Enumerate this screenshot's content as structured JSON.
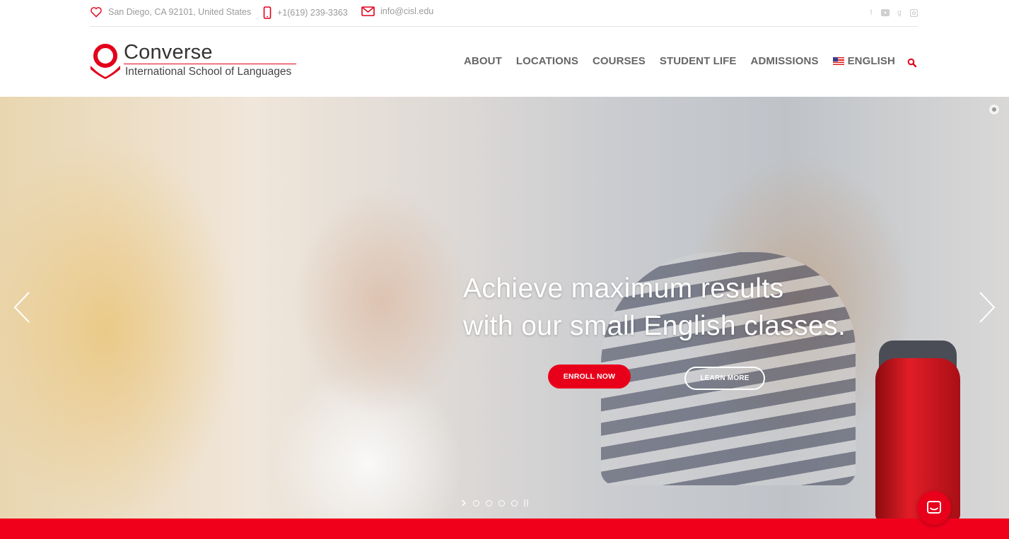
{
  "topbar": {
    "address": "San Diego, CA 92101, United States",
    "phone": "+1(619) 239-3363",
    "email": "info@cisl.edu",
    "social": [
      "facebook-icon",
      "youtube-icon",
      "google-plus-icon",
      "instagram-icon"
    ]
  },
  "logo": {
    "word": "Converse",
    "subtitle": "International School of Languages"
  },
  "nav": {
    "items": [
      "ABOUT",
      "LOCATIONS",
      "COURSES",
      "STUDENT LIFE",
      "ADMISSIONS"
    ],
    "language": "ENGLISH"
  },
  "hero": {
    "headline_line1": "Achieve maximum results",
    "headline_line2": "with our small English classes.",
    "enroll_label": "ENROLL NOW",
    "learn_label": "LEARN MORE",
    "slide_count": 4
  },
  "colors": {
    "brand_red": "#e8001b",
    "nav_text": "#666666",
    "topbar_text": "#9a9a9a"
  }
}
